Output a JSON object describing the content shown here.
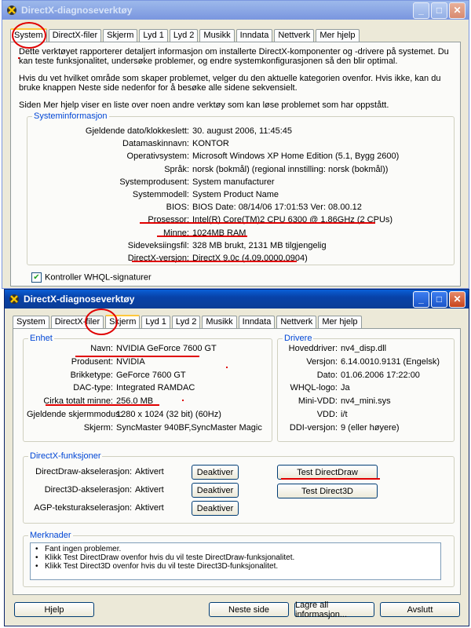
{
  "back_window": {
    "title": "DirectX-diagnoseverktøy",
    "tabs": [
      "System",
      "DirectX-filer",
      "Skjerm",
      "Lyd 1",
      "Lyd 2",
      "Musikk",
      "Inndata",
      "Nettverk",
      "Mer hjelp"
    ],
    "selected_tab": "System",
    "description": [
      "Dette verktøyet rapporterer detaljert informasjon om installerte DirectX-komponenter og -drivere på systemet. Du kan teste funksjonalitet, undersøke problemer, og endre systemkonfigurasjonen så den blir optimal.",
      "Hvis du vet hvilket område som skaper problemet, velger du den aktuelle kategorien ovenfor. Hvis ikke, kan du bruke knappen Neste side nedenfor for å besøke alle sidene sekvensielt.",
      "Siden Mer hjelp viser en liste over noen andre verktøy som kan løse problemet som har oppstått."
    ],
    "sysinfo": {
      "label": "Systeminformasjon",
      "rows": [
        {
          "k": "Gjeldende dato/klokkeslett:",
          "v": "30. august 2006, 11:45:45"
        },
        {
          "k": "Datamaskinnavn:",
          "v": "KONTOR"
        },
        {
          "k": "Operativsystem:",
          "v": "Microsoft Windows XP Home Edition (5.1, Bygg 2600)"
        },
        {
          "k": "Språk:",
          "v": "norsk (bokmål) (regional innstilling: norsk (bokmål))"
        },
        {
          "k": "Systemprodusent:",
          "v": "System manufacturer"
        },
        {
          "k": "Systemmodell:",
          "v": "System Product Name"
        },
        {
          "k": "BIOS:",
          "v": "BIOS Date: 08/14/06 17:01:53 Ver: 08.00.12"
        },
        {
          "k": "Prosessor:",
          "v": "Intel(R) Core(TM)2 CPU          6300  @ 1.86GHz (2 CPUs)"
        },
        {
          "k": "Minne:",
          "v": "1024MB RAM"
        },
        {
          "k": "Sideveksiingsfil:",
          "v": "328 MB brukt, 2131 MB tilgjengelig"
        },
        {
          "k": "DirectX-versjon:",
          "v": "DirectX 9.0c (4.09.0000.0904)"
        }
      ]
    },
    "whql_label": "Kontroller WHQL-signaturer"
  },
  "front_window": {
    "title": "DirectX-diagnoseverktøy",
    "tabs": [
      "System",
      "DirectX-filer",
      "Skjerm",
      "Lyd 1",
      "Lyd 2",
      "Musikk",
      "Inndata",
      "Nettverk",
      "Mer hjelp"
    ],
    "selected_tab": "Skjerm",
    "device": {
      "label": "Enhet",
      "rows": [
        {
          "k": "Navn:",
          "v": "NVIDIA GeForce 7600 GT"
        },
        {
          "k": "Produsent:",
          "v": "NVIDIA"
        },
        {
          "k": "Brikketype:",
          "v": "GeForce 7600 GT"
        },
        {
          "k": "DAC-type:",
          "v": "Integrated RAMDAC"
        },
        {
          "k": "Cirka totalt minne:",
          "v": "256.0 MB"
        },
        {
          "k": "Gjeldende skjermmodus:",
          "v": "1280 x 1024 (32 bit) (60Hz)"
        },
        {
          "k": "Skjerm:",
          "v": "SyncMaster 940BF,SyncMaster Magic"
        }
      ]
    },
    "drivers": {
      "label": "Drivere",
      "rows": [
        {
          "k": "Hoveddriver:",
          "v": "nv4_disp.dll"
        },
        {
          "k": "Versjon:",
          "v": "6.14.0010.9131 (Engelsk)"
        },
        {
          "k": "Dato:",
          "v": "01.06.2006 17:22:00"
        },
        {
          "k": "WHQL-logo:",
          "v": "Ja"
        },
        {
          "k": "Mini-VDD:",
          "v": "nv4_mini.sys"
        },
        {
          "k": "VDD:",
          "v": "i/t"
        },
        {
          "k": "DDI-versjon:",
          "v": "9 (eller høyere)"
        }
      ]
    },
    "features": {
      "label": "DirectX-funksjoner",
      "rows": [
        {
          "k": "DirectDraw-akselerasjon:",
          "v": "Aktivert",
          "btn": "Deaktiver"
        },
        {
          "k": "Direct3D-akselerasjon:",
          "v": "Aktivert",
          "btn": "Deaktiver"
        },
        {
          "k": "AGP-teksturakselerasjon:",
          "v": "Aktivert",
          "btn": "Deaktiver"
        }
      ],
      "test_directdraw": "Test DirectDraw",
      "test_direct3d": "Test Direct3D"
    },
    "notes": {
      "label": "Merknader",
      "items": [
        "Fant ingen problemer.",
        "Klikk Test DirectDraw ovenfor hvis du vil teste DirectDraw-funksjonalitet.",
        "Klikk Test Direct3D ovenfor hvis du vil teste Direct3D-funksjonalitet."
      ]
    },
    "buttons": {
      "help": "Hjelp",
      "next": "Neste side",
      "save": "Lagre all informasjon...",
      "exit": "Avslutt"
    }
  },
  "window_controls": {
    "minimize": "_",
    "maximize": "□",
    "close": "✕"
  },
  "annotation_color": "#e00000"
}
